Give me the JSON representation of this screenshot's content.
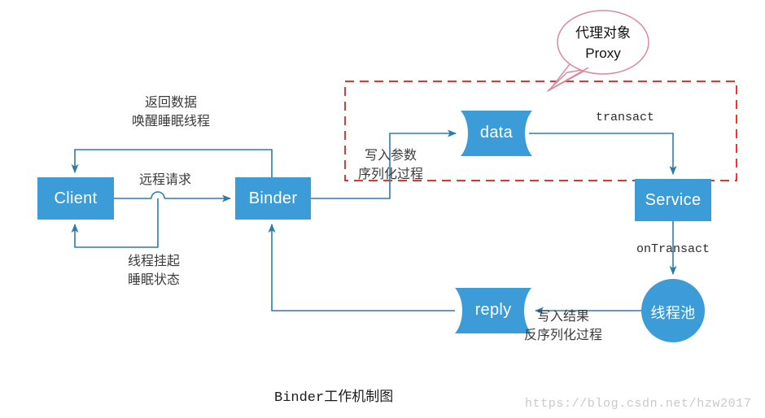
{
  "diagram": {
    "caption": "Binder工作机制图",
    "watermark": "https://blog.csdn.net/hzw2017",
    "colors": {
      "node_fill": "#3c9cd8",
      "edge_stroke": "#2e7bab",
      "boundary_dashed": "#ee1111",
      "callout_stroke": "#d98a9e",
      "label_text": "#3b3b3b",
      "node_text": "#ffffff",
      "watermark_text": "#c9c9cd"
    },
    "nodes": [
      {
        "id": "client",
        "label": "Client",
        "shape": "rect"
      },
      {
        "id": "binder",
        "label": "Binder",
        "shape": "rect"
      },
      {
        "id": "data",
        "label": "data",
        "shape": "flag"
      },
      {
        "id": "service",
        "label": "Service",
        "shape": "rect"
      },
      {
        "id": "threadpool",
        "label": "线程池",
        "shape": "circle"
      },
      {
        "id": "reply",
        "label": "reply",
        "shape": "flag"
      }
    ],
    "edge_labels": {
      "remote_request": "远程请求",
      "return_data_line1": "返回数据",
      "return_data_line2": "唤醒睡眠线程",
      "thread_suspend_line1": "线程挂起",
      "thread_suspend_line2": "睡眠状态",
      "write_params_line1": "写入参数",
      "write_params_line2": "序列化过程",
      "transact": "transact",
      "on_transact": "onTransact",
      "write_result_line1": "写入结果",
      "write_result_line2": "反序列化过程"
    },
    "callout": {
      "line1": "代理对象",
      "line2": "Proxy"
    },
    "boundary": {
      "name": "proxy-scope-boundary"
    }
  }
}
